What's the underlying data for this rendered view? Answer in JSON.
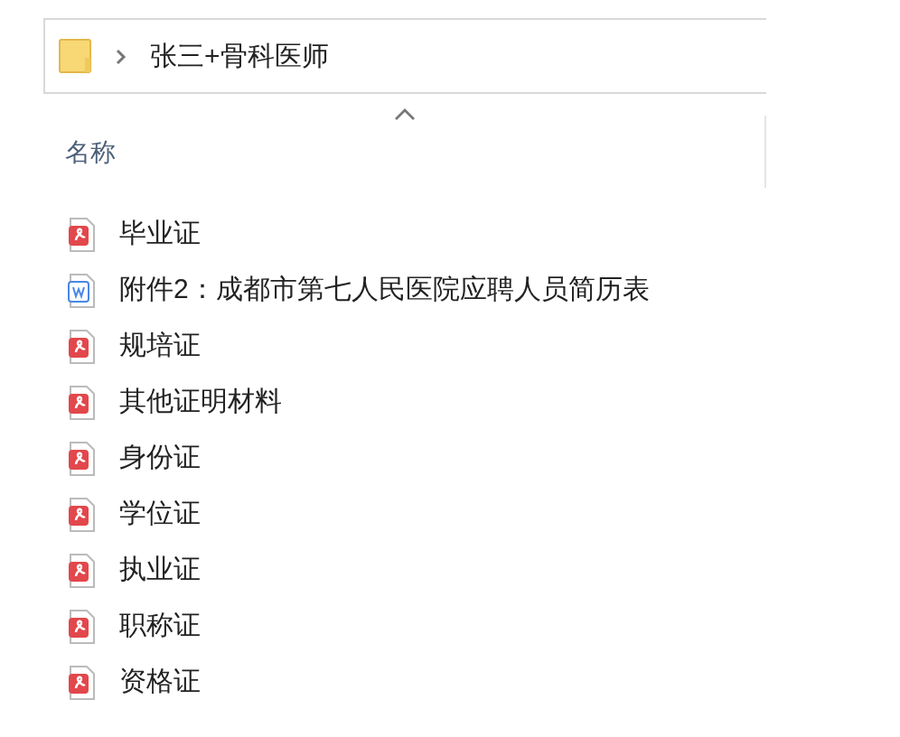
{
  "address_bar": {
    "path": "张三+骨科医师"
  },
  "column_header": {
    "label": "名称",
    "sorted_ascending": true
  },
  "files": [
    {
      "name": "毕业证",
      "kind": "pdf"
    },
    {
      "name": "附件2：成都市第七人民医院应聘人员简历表",
      "kind": "word"
    },
    {
      "name": "规培证",
      "kind": "pdf"
    },
    {
      "name": "其他证明材料",
      "kind": "pdf"
    },
    {
      "name": "身份证",
      "kind": "pdf"
    },
    {
      "name": "学位证",
      "kind": "pdf"
    },
    {
      "name": "执业证",
      "kind": "pdf"
    },
    {
      "name": "职称证",
      "kind": "pdf"
    },
    {
      "name": "资格证",
      "kind": "pdf"
    }
  ]
}
